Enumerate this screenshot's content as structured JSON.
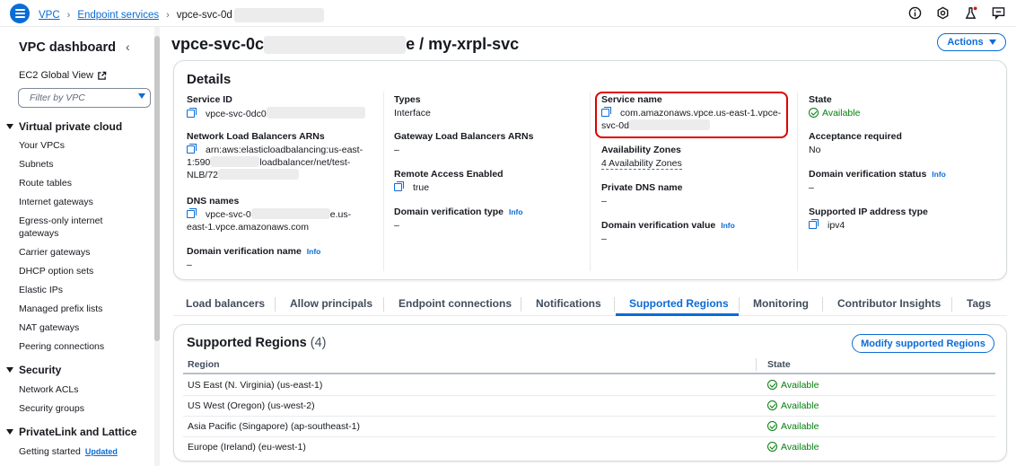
{
  "breadcrumb": {
    "items": [
      "VPC",
      "Endpoint services",
      "vpce-svc-0d"
    ]
  },
  "sidebar": {
    "title": "VPC dashboard",
    "global_view": "EC2 Global View",
    "filter_placeholder": "Filter by VPC",
    "sections": [
      {
        "label": "Virtual private cloud",
        "items": [
          "Your VPCs",
          "Subnets",
          "Route tables",
          "Internet gateways",
          "Egress-only internet gateways",
          "Carrier gateways",
          "DHCP option sets",
          "Elastic IPs",
          "Managed prefix lists",
          "NAT gateways",
          "Peering connections"
        ]
      },
      {
        "label": "Security",
        "items": [
          "Network ACLs",
          "Security groups"
        ]
      },
      {
        "label": "PrivateLink and Lattice",
        "items": [
          "Getting started"
        ]
      }
    ],
    "updated_badge": "Updated"
  },
  "page": {
    "title_prefix": "vpce-svc-0c",
    "title_suffix": "e / my-xrpl-svc",
    "actions_label": "Actions"
  },
  "details": {
    "heading": "Details",
    "service_id_label": "Service ID",
    "service_id_value": "vpce-svc-0dc0",
    "nlb_label": "Network Load Balancers ARNs",
    "nlb_line1": "arn:aws:elasticloadbalancing:us-east-",
    "nlb_line2a": "1:590",
    "nlb_line2b": "loadbalancer/net/test-",
    "nlb_line3": "NLB/72",
    "dns_label": "DNS names",
    "dns_line1a": "vpce-svc-0",
    "dns_line1b": "e.us-",
    "dns_line2": "east-1.vpce.amazonaws.com",
    "domain_name_label": "Domain verification name",
    "domain_name_value": "–",
    "types_label": "Types",
    "types_value": "Interface",
    "gwlb_label": "Gateway Load Balancers ARNs",
    "gwlb_value": "–",
    "remote_label": "Remote Access Enabled",
    "remote_value": "true",
    "domain_type_label": "Domain verification type",
    "domain_type_value": "–",
    "service_name_label": "Service name",
    "service_name_line1": "com.amazonaws.vpce.us-east-1.vpce-",
    "service_name_line2": "svc-0d",
    "az_label": "Availability Zones",
    "az_value": "4 Availability Zones",
    "private_dns_label": "Private DNS name",
    "private_dns_value": "–",
    "domain_value_label": "Domain verification value",
    "domain_value_value": "–",
    "state_label": "State",
    "state_value": "Available",
    "acceptance_label": "Acceptance required",
    "acceptance_value": "No",
    "domain_status_label": "Domain verification status",
    "domain_status_value": "–",
    "ip_type_label": "Supported IP address type",
    "ip_type_value": "ipv4",
    "info": "Info"
  },
  "tabs": [
    "Load balancers",
    "Allow principals",
    "Endpoint connections",
    "Notifications",
    "Supported Regions",
    "Monitoring",
    "Contributor Insights",
    "Tags"
  ],
  "regions": {
    "title": "Supported Regions",
    "count": "(4)",
    "modify_label": "Modify supported Regions",
    "col_region": "Region",
    "col_state": "State",
    "rows": [
      {
        "region": "US East (N. Virginia) (us-east-1)",
        "state": "Available"
      },
      {
        "region": "US West (Oregon) (us-west-2)",
        "state": "Available"
      },
      {
        "region": "Asia Pacific (Singapore) (ap-southeast-1)",
        "state": "Available"
      },
      {
        "region": "Europe (Ireland) (eu-west-1)",
        "state": "Available"
      }
    ]
  },
  "colors": {
    "accent": "#0a6cd6",
    "success": "#037f0c",
    "highlight": "#dd0000"
  },
  "icons": [
    "menu-icon",
    "info-circle-icon",
    "settings-icon",
    "lab-flask-icon",
    "feedback-icon",
    "external-link-icon",
    "copy-icon",
    "success-check-icon"
  ]
}
